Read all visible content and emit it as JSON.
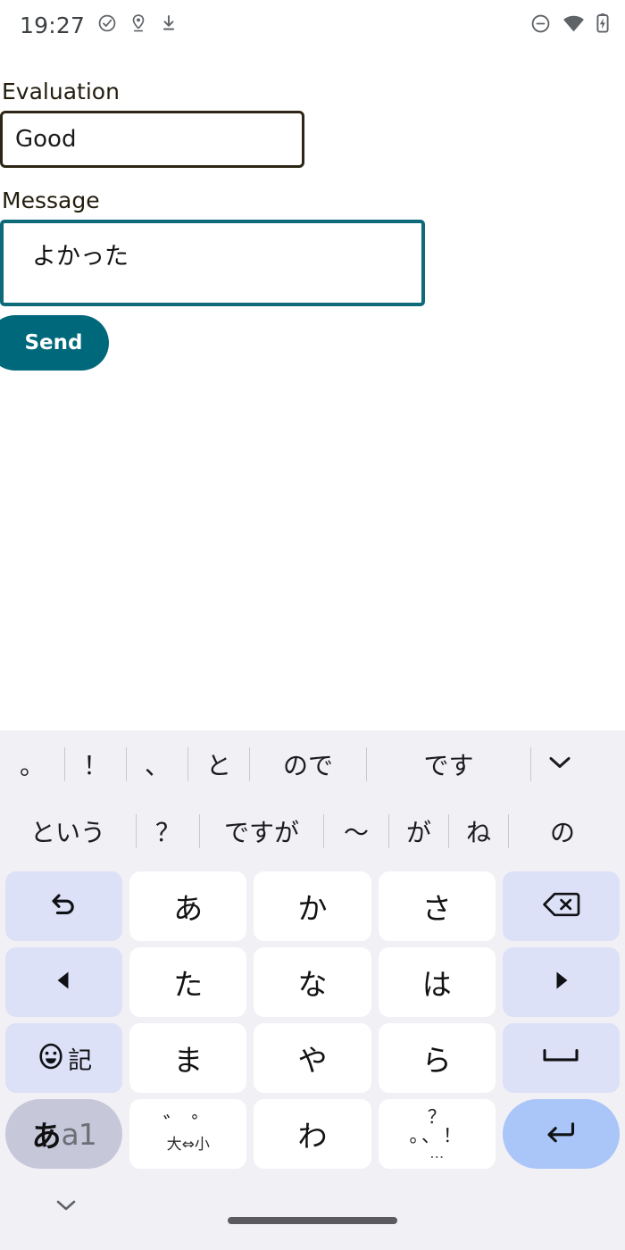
{
  "status_bar": {
    "time": "19:27",
    "left_icons": [
      "check-circle-icon",
      "location-pin-icon",
      "download-icon"
    ],
    "right_icons": [
      "do-not-disturb-icon",
      "wifi-icon",
      "battery-charging-icon"
    ]
  },
  "form": {
    "evaluation": {
      "label": "Evaluation",
      "value": "Good",
      "placeholder": "",
      "border_color": "#2d2616"
    },
    "message": {
      "label": "Message",
      "value": "よかった",
      "placeholder": "",
      "border_color": "#0c6a79",
      "focused": true
    },
    "send_button": {
      "label": "Send",
      "color": "#00687b",
      "text_color": "#ffffff"
    }
  },
  "keyboard": {
    "background": "#f1f0f5",
    "suggestions_row_1": [
      "。",
      "！",
      "、",
      "と",
      "ので",
      "です"
    ],
    "suggestions_row_2": [
      "という",
      "？",
      "ですが",
      "〜",
      "が",
      "ね",
      "の"
    ],
    "expand_icon": "chevron-down-icon",
    "rows": [
      [
        {
          "name": "undo-key",
          "glyph": "�averted",
          "display": "↶",
          "type": "func"
        },
        {
          "name": "key-a",
          "display": "あ",
          "type": "char"
        },
        {
          "name": "key-ka",
          "display": "か",
          "type": "char"
        },
        {
          "name": "key-sa",
          "display": "さ",
          "type": "char"
        },
        {
          "name": "backspace-key",
          "display": "⌫",
          "type": "func"
        }
      ],
      [
        {
          "name": "cursor-left-key",
          "display": "◀",
          "type": "func"
        },
        {
          "name": "key-ta",
          "display": "た",
          "type": "char"
        },
        {
          "name": "key-na",
          "display": "な",
          "type": "char"
        },
        {
          "name": "key-ha",
          "display": "は",
          "type": "char"
        },
        {
          "name": "cursor-right-key",
          "display": "▶",
          "type": "func"
        }
      ],
      [
        {
          "name": "emoji-symbol-key",
          "display": "記",
          "type": "func"
        },
        {
          "name": "key-ma",
          "display": "ま",
          "type": "char"
        },
        {
          "name": "key-ya",
          "display": "や",
          "type": "char"
        },
        {
          "name": "key-ra",
          "display": "ら",
          "type": "char"
        },
        {
          "name": "space-key",
          "display": "␣",
          "type": "func"
        }
      ],
      [
        {
          "name": "input-mode-key",
          "display": "あa1",
          "type": "mode"
        },
        {
          "name": "dakuten-key",
          "display": "゛゜ 大⇔小",
          "type": "char"
        },
        {
          "name": "key-wa",
          "display": "わ",
          "type": "char"
        },
        {
          "name": "punctuation-key",
          "display": "、。？！ …",
          "type": "char"
        },
        {
          "name": "enter-key",
          "display": "↵",
          "type": "enter"
        }
      ]
    ],
    "mode_key": {
      "primary": "あ",
      "secondary": "a1"
    },
    "dakuten_key": {
      "top": "゛ ゜",
      "bottom": "大⇔小"
    },
    "punctuation_key": {
      "top": "？",
      "middle": "。、！",
      "bottom": "…"
    },
    "hide_keyboard_icon": "chevron-down-icon",
    "home_indicator": "home-gesture-bar"
  }
}
